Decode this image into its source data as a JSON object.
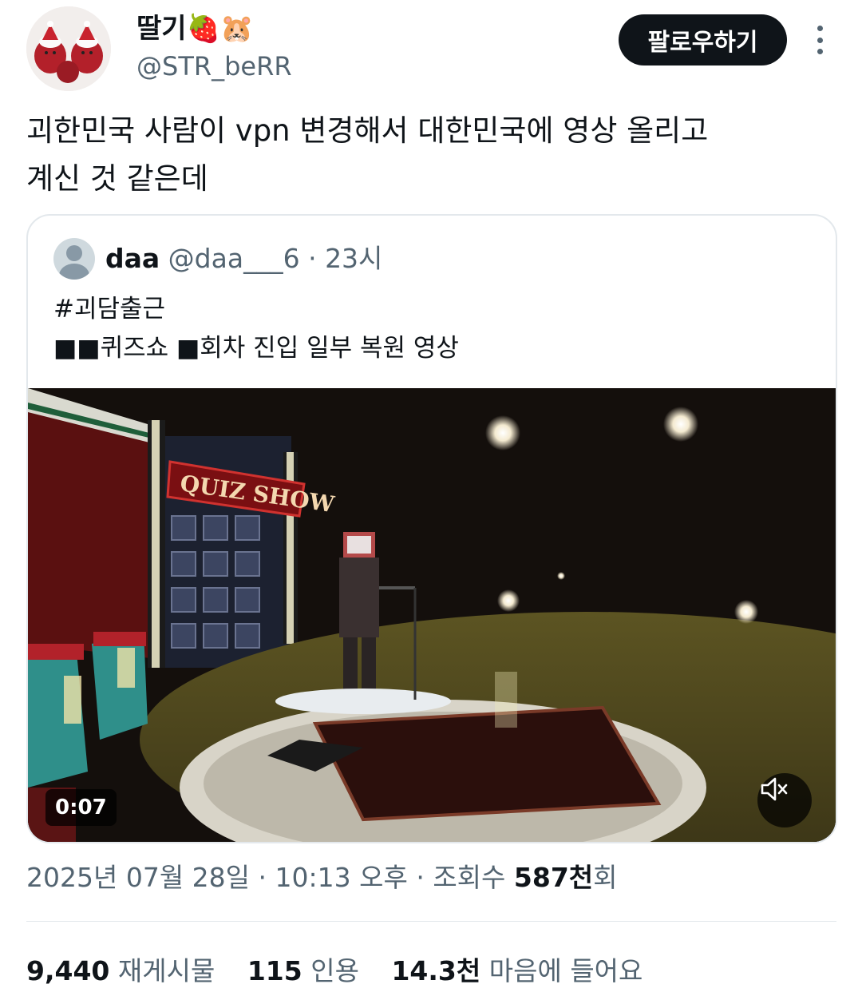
{
  "author": {
    "display_name": "딸기🍓🐹",
    "handle": "@STR_beRR"
  },
  "follow_label": "팔로우하기",
  "tweet_text": {
    "line1": "괴한민국 사람이 vpn 변경해서 대한민국에 영상 올리고",
    "line2": "계신 것 같은데"
  },
  "quote": {
    "name": "daa",
    "handle": "@daa___6",
    "separator": "·",
    "time": "23시",
    "hashtag": "#괴담출근",
    "body": "■■퀴즈쇼 ■회차 진입 일부 복원 영상",
    "video": {
      "duration": "0:07",
      "sign_text": "QUIZ SHOW",
      "muted": true
    }
  },
  "timestamp": {
    "date": "2025년 07월 28일",
    "sep1": " · ",
    "time": "10:13 오후",
    "sep2": " · ",
    "views_label": "조회수 ",
    "views_count": "587천",
    "views_suffix": "회"
  },
  "stats": {
    "reposts_count": "9,440",
    "reposts_label": "재게시물",
    "quotes_count": "115",
    "quotes_label": "인용",
    "likes_count": "14.3천",
    "likes_label": "마음에 들어요"
  },
  "colors": {
    "text": "#0f1419",
    "secondary": "#536471",
    "border": "#e3e8ec",
    "follow_bg": "#0f1419"
  },
  "icons": [
    "more-icon",
    "default-avatar-icon",
    "mute-icon"
  ]
}
